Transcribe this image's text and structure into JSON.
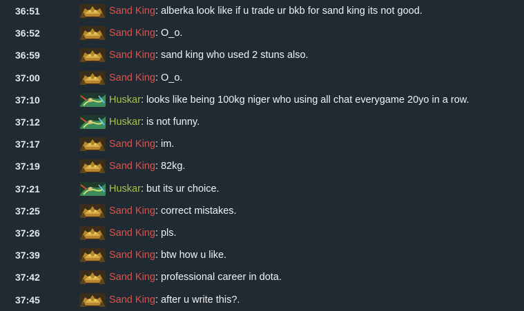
{
  "colors": {
    "background": "#1f2a33",
    "radiant_name": "#a9c449",
    "dire_name": "#e0524a",
    "text": "#f2f2f2",
    "timestamp": "#e4e7ea"
  },
  "messages": [
    {
      "time": "36:51",
      "hero": "Sand King",
      "team": "red",
      "icon": "sand-king-icon",
      "text": "alberka look like if u trade ur bkb for sand king its not good."
    },
    {
      "time": "36:52",
      "hero": "Sand King",
      "team": "red",
      "icon": "sand-king-icon",
      "text": "O_o."
    },
    {
      "time": "36:59",
      "hero": "Sand King",
      "team": "red",
      "icon": "sand-king-icon",
      "text": "sand king who used 2 stuns also."
    },
    {
      "time": "37:00",
      "hero": "Sand King",
      "team": "red",
      "icon": "sand-king-icon",
      "text": "O_o."
    },
    {
      "time": "37:10",
      "hero": "Huskar",
      "team": "green",
      "icon": "huskar-icon",
      "text": "looks like being 100kg niger who using all chat everygame 20yo in a row."
    },
    {
      "time": "37:12",
      "hero": "Huskar",
      "team": "green",
      "icon": "huskar-icon",
      "text": "is not funny."
    },
    {
      "time": "37:17",
      "hero": "Sand King",
      "team": "red",
      "icon": "sand-king-icon",
      "text": "im."
    },
    {
      "time": "37:19",
      "hero": "Sand King",
      "team": "red",
      "icon": "sand-king-icon",
      "text": "82kg."
    },
    {
      "time": "37:21",
      "hero": "Huskar",
      "team": "green",
      "icon": "huskar-icon",
      "text": "but its ur choice."
    },
    {
      "time": "37:25",
      "hero": "Sand King",
      "team": "red",
      "icon": "sand-king-icon",
      "text": "correct mistakes."
    },
    {
      "time": "37:26",
      "hero": "Sand King",
      "team": "red",
      "icon": "sand-king-icon",
      "text": "pls."
    },
    {
      "time": "37:39",
      "hero": "Sand King",
      "team": "red",
      "icon": "sand-king-icon",
      "text": "btw how u like."
    },
    {
      "time": "37:42",
      "hero": "Sand King",
      "team": "red",
      "icon": "sand-king-icon",
      "text": "professional career in dota."
    },
    {
      "time": "37:45",
      "hero": "Sand King",
      "team": "red",
      "icon": "sand-king-icon",
      "text": "after u write this?."
    }
  ]
}
